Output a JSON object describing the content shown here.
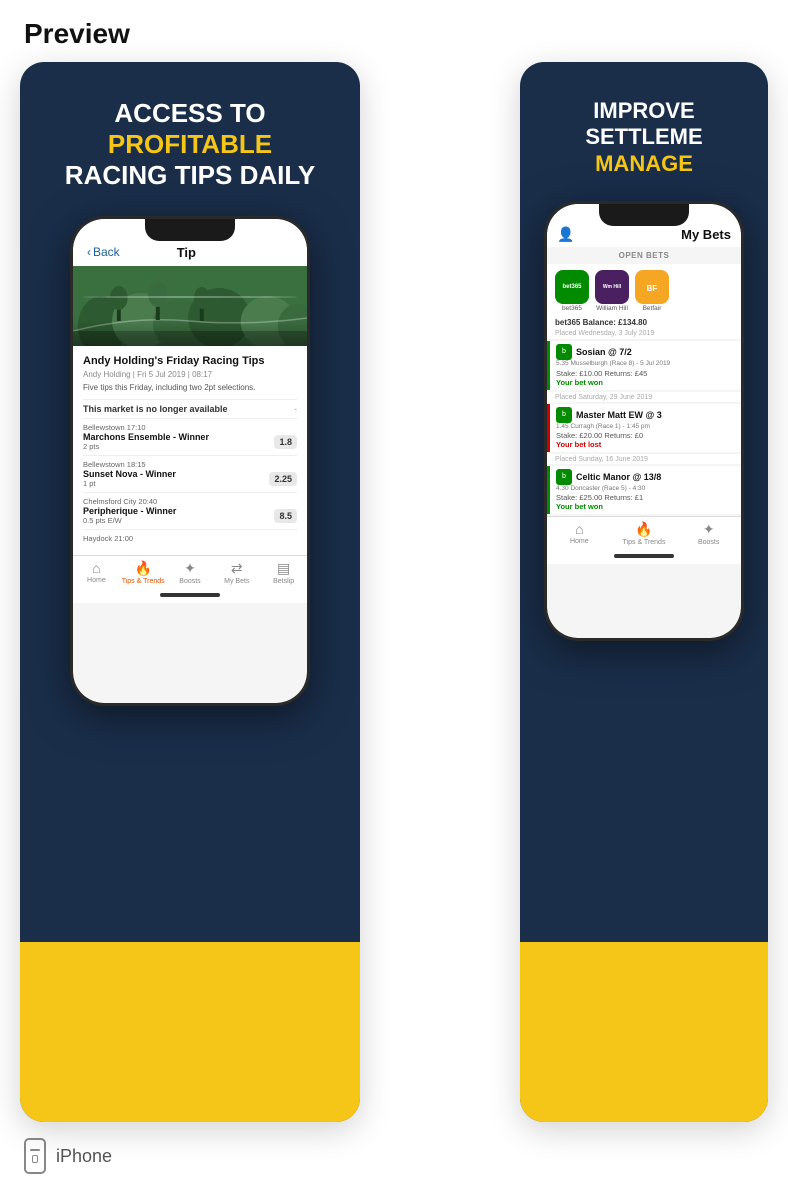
{
  "page": {
    "title": "Preview",
    "iphone_label": "iPhone"
  },
  "left_card": {
    "line1": "ACCESS TO",
    "line_yellow": "PROFITABLE",
    "line2": "RACING TIPS DAILY",
    "nav": {
      "back": "Back",
      "title": "Tip"
    },
    "article": {
      "title": "Andy Holding's Friday Racing Tips",
      "meta": "Andy Holding | Fri 5 Jul 2019 | 08:17",
      "desc": "Five tips this Friday, including two 2pt selections.",
      "market_unavailable": "This market is no longer available",
      "market_dash": "-"
    },
    "tips": [
      {
        "venue": "Bellewstown 17:10",
        "horse": "Marchons Ensemble - Winner",
        "pts": "2 pts",
        "odds": "1.8"
      },
      {
        "venue": "Bellewstown 18:15",
        "horse": "Sunset Nova - Winner",
        "pts": "1 pt",
        "odds": "2.25"
      },
      {
        "venue": "Chelmsford City 20:40",
        "horse": "Peripherique - Winner",
        "pts": "0.5 pts E/W",
        "odds": "8.5"
      },
      {
        "venue": "Haydock 21:00",
        "horse": "",
        "pts": "",
        "odds": ""
      }
    ],
    "tabs": [
      {
        "label": "Home",
        "icon": "🏠",
        "active": false
      },
      {
        "label": "Tips & Trends",
        "icon": "🔥",
        "active": true
      },
      {
        "label": "Boosts",
        "icon": "🚀",
        "active": false
      },
      {
        "label": "My Bets",
        "icon": "⇄",
        "active": false
      },
      {
        "label": "Betslip",
        "icon": "📋",
        "active": false
      }
    ]
  },
  "right_card": {
    "line1": "IMPROVE",
    "line2": "SETTLEME",
    "line_yellow": "MANAGE",
    "nav": {
      "title": "My Bets"
    },
    "open_bets_label": "OPEN BETS",
    "bookmakers": [
      {
        "name": "bet365",
        "label": "bet365",
        "color": "028b00"
      },
      {
        "name": "William Hill",
        "label": "William Hill",
        "color": "4a2060"
      },
      {
        "name": "Betfair",
        "label": "Betfair",
        "color": "f5a623"
      }
    ],
    "balance": "bet365 Balance: £134.80",
    "placed_date_1": "Placed Wednesday, 3 July 2019",
    "bets": [
      {
        "horse": "Sosian @ 7/2",
        "race": "5.35 Musselburgh (Race 8) - 5 Jul 2019",
        "stake": "Stake: £10.00 Returns: £45",
        "result": "Your bet won",
        "won": true
      },
      {
        "placed": "Placed Saturday, 29 June 2019",
        "horse": "Master Matt EW @ 3",
        "race": "1.45 Curragh (Race 1) - 1:45 pm",
        "stake": "Stake: £20.00 Returns: £0",
        "result": "Your bet lost",
        "won": false
      },
      {
        "placed": "Placed Sunday, 16 June 2019",
        "horse": "Celtic Manor @ 13/8",
        "race": "4.30 Doncaster (Race 5) - 4:30",
        "stake": "Stake: £25.00 Returns: £1",
        "result": "Your bet won",
        "won": true
      }
    ],
    "tabs": [
      {
        "label": "Home",
        "icon": "🏠",
        "active": false
      },
      {
        "label": "Tips & Trends",
        "icon": "🔥",
        "active": false
      },
      {
        "label": "Boosts",
        "icon": "🚀",
        "active": false
      }
    ]
  }
}
